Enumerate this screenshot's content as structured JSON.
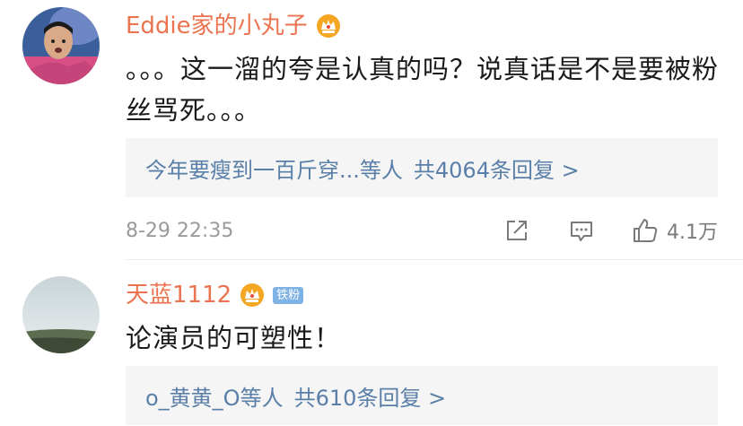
{
  "comments": [
    {
      "username": "Eddie家的小丸子",
      "badges": [
        "vip-crown-icon"
      ],
      "text": "。。。这一溜的夸是认真的吗？说真话是不是要被粉丝骂死。。。",
      "replies": {
        "names": "今年要瘦到一百斤穿...等人",
        "count": "共4064条回复 >"
      },
      "timestamp": "8-29 22:35",
      "likes": "4.1万"
    },
    {
      "username": "天蓝1112",
      "badges": [
        "vip-crown-icon",
        "铁粉"
      ],
      "text": "论演员的可塑性！",
      "replies": {
        "names": "o_黄黄_O等人",
        "count": "共610条回复 >"
      }
    }
  ],
  "colors": {
    "username": "#eb7350",
    "reply_link": "#5a7fa8",
    "reply_bg": "#f5f5f5",
    "fan_badge": "#7fb2e5",
    "crown": "#f5a623"
  }
}
